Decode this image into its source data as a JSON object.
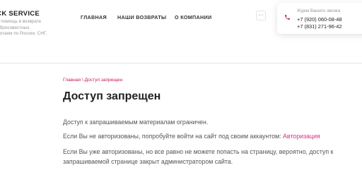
{
  "header": {
    "logo_title": "ACK SERVICE",
    "logo_sub_lines": [
      "я помощь в возврате",
      "обросовестных",
      "ботаем по России, СНГ,"
    ],
    "nav": [
      "ГЛАВНАЯ",
      "НАШИ ВОЗВРАТЫ",
      "О КОМПАНИИ"
    ],
    "more_label": "···",
    "phone_hint": "Ждем Вашего звонка",
    "phone_1": "+7 (920) 060-08-48",
    "phone_2": "+7 (831) 271-96-42",
    "accent_color": "#c2185b"
  },
  "breadcrumb": {
    "home": "Главная",
    "separator": " \\ ",
    "current": "Доступ запрещен"
  },
  "page_title": "Доступ запрещен",
  "body": {
    "p1": "Доступ к запрашиваемым материалам ограничен.",
    "p2_text": "Если Вы не авторизованы, попробуйте войти на сайт под своим аккаунтом: ",
    "p2_link": "Авторизация",
    "p3_line1": "Если Вы уже авторизованы, но все равно не можете попасть на страницу, вероятно, доступ к",
    "p3_line2": "запрашиваемой странице закрыт администратором сайта."
  }
}
